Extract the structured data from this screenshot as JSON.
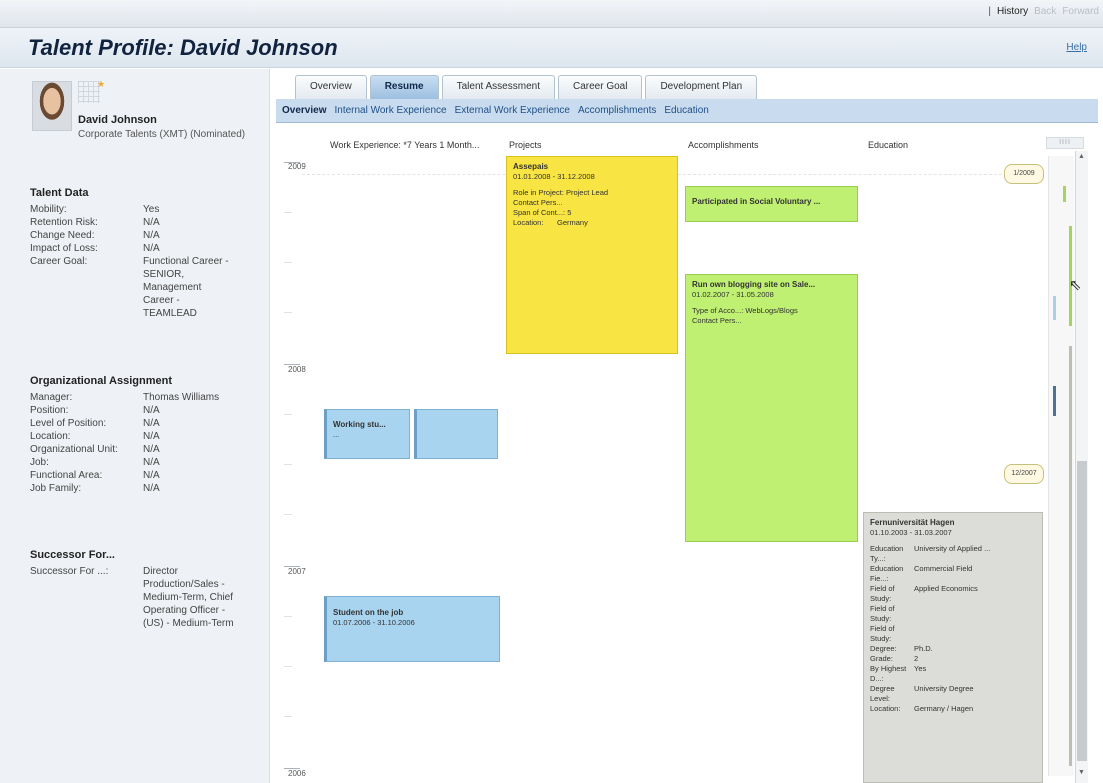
{
  "topnav": {
    "history": "History",
    "back": "Back",
    "forward": "Forward"
  },
  "page": {
    "title": "Talent Profile: David Johnson",
    "help": "Help"
  },
  "profile": {
    "name": "David Johnson",
    "org": "Corporate Talents (XMT) (Nominated)"
  },
  "talent_data": {
    "heading": "Talent Data",
    "rows": [
      {
        "k": "Mobility:",
        "v": "Yes"
      },
      {
        "k": "Retention Risk:",
        "v": "N/A"
      },
      {
        "k": "Change Need:",
        "v": "N/A"
      },
      {
        "k": "Impact of Loss:",
        "v": "N/A"
      },
      {
        "k": "Career Goal:",
        "v": "Functional Career - SENIOR, Management Career - TEAMLEAD"
      }
    ]
  },
  "org_assignment": {
    "heading": "Organizational Assignment",
    "rows": [
      {
        "k": "Manager:",
        "v": "Thomas Williams"
      },
      {
        "k": "Position:",
        "v": "N/A"
      },
      {
        "k": "Level of Position:",
        "v": "N/A"
      },
      {
        "k": "Location:",
        "v": "N/A"
      },
      {
        "k": "Organizational Unit:",
        "v": "N/A"
      },
      {
        "k": "Job:",
        "v": "N/A"
      },
      {
        "k": "Functional Area:",
        "v": "N/A"
      },
      {
        "k": "Job Family:",
        "v": "N/A"
      }
    ]
  },
  "successor": {
    "heading": "Successor For...",
    "rows": [
      {
        "k": "Successor For ...:",
        "v": "Director Production/Sales - Medium-Term, Chief Operating Officer - (US) - Medium-Term"
      }
    ]
  },
  "tabs": [
    "Overview",
    "Resume",
    "Talent Assessment",
    "Career Goal",
    "Development Plan"
  ],
  "subnav": [
    "Overview",
    "Internal Work Experience",
    "External Work Experience",
    "Accomplishments",
    "Education"
  ],
  "columns": {
    "work": "Work Experience: *7 Years 1 Month...",
    "projects": "Projects",
    "accomplishments": "Accomplishments",
    "education": "Education"
  },
  "control_box": "IIII",
  "years": [
    "2009",
    "2008",
    "2007",
    "2006"
  ],
  "bubbles": [
    "1/2009",
    "12/2007"
  ],
  "cards": {
    "project": {
      "title": "Assepais",
      "dates": "01.01.2008 - 31.12.2008",
      "lines": [
        "Role in Project: Project Lead",
        "Contact Pers...",
        "Span of Cont...: 5"
      ],
      "loc_k": "Location:",
      "loc_v": "Germany"
    },
    "acc1": {
      "title": "Participated in Social Voluntary ..."
    },
    "acc2": {
      "title": "Run own blogging site on Sale...",
      "dates": "01.02.2007 - 31.05.2008",
      "lines": [
        "Type of Acco...: WebLogs/Blogs",
        "Contact Pers..."
      ]
    },
    "work1": {
      "title": "Working stu...",
      "sub": "..."
    },
    "work2": {
      "title": "Student on the job",
      "dates": "01.07.2006 - 31.10.2006"
    },
    "edu": {
      "title": "Fernuniversität Hagen",
      "dates": "01.10.2003 - 31.03.2007",
      "rows": [
        {
          "k": "Education Ty...:",
          "v": "University of Applied ..."
        },
        {
          "k": "Education Fie...:",
          "v": "Commercial Field"
        },
        {
          "k": "Field of Study:",
          "v": "Applied Economics"
        },
        {
          "k": "Field of Study:",
          "v": ""
        },
        {
          "k": "Field of Study:",
          "v": ""
        },
        {
          "k": "Degree:",
          "v": "Ph.D."
        },
        {
          "k": "Grade:",
          "v": "2"
        },
        {
          "k": "By Highest D...:",
          "v": "Yes"
        },
        {
          "k": "Degree Level:",
          "v": "University Degree"
        },
        {
          "k": "Location:",
          "v": "Germany / Hagen"
        }
      ]
    }
  },
  "colors": {
    "project": "#f8e442",
    "accomplishment": "#bff072",
    "work": "#a9d4ef",
    "education": "#dcdcd8",
    "tab_active": "#9dbfe0"
  }
}
